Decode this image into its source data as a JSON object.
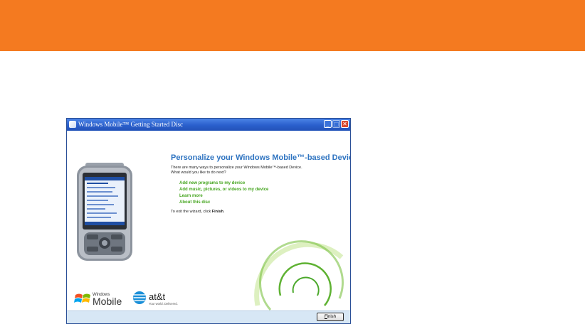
{
  "window": {
    "title": "Windows Mobile™ Getting Started Disc",
    "minimize_glyph": "_",
    "maximize_glyph": "□",
    "close_glyph": "✕"
  },
  "content": {
    "heading": "Personalize your Windows Mobile™-based Device",
    "intro_line1": "There are many ways to personalize your Windows Mobile™-based Device.",
    "intro_line2": "What would you like to do next?",
    "options": [
      "Add new programs to my device",
      "Add music, pictures, or videos to my device",
      "Learn more",
      "About this disc"
    ],
    "exit_prefix": "To exit the wizard, click ",
    "exit_bold": "Finish",
    "exit_suffix": "."
  },
  "logos": {
    "windows_small": "Windows",
    "mobile": "Mobile",
    "att": "at&t",
    "att_tagline": "Your world. Delivered."
  },
  "footer": {
    "finish_label": "Finish"
  },
  "colors": {
    "banner": "#f47a20",
    "heading": "#2f74c1",
    "link": "#45a51f",
    "titlebar": "#2a5fcc",
    "footer": "#d7e7f5"
  },
  "icons": {
    "app": "windows-mobile-app-icon",
    "phone": "pda-phone-illustration",
    "swirl": "green-swirl-graphic"
  }
}
